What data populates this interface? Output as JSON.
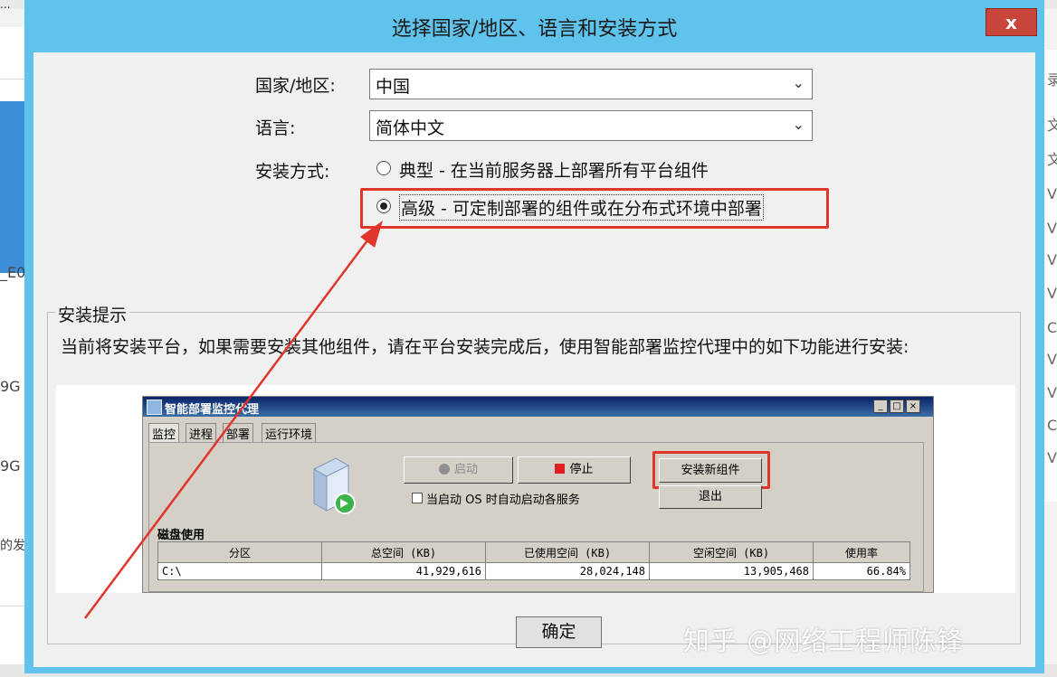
{
  "background": {
    "top_text": "...",
    "left_texts": [
      "_E0",
      "9G",
      "9G",
      "的发"
    ],
    "right_texts": [
      "录",
      "文",
      "文",
      "V",
      "V",
      "V",
      "V",
      "C",
      "V",
      "V",
      "C",
      "V"
    ]
  },
  "dialog": {
    "title": "选择国家/地区、语言和安装方式",
    "close_label": "x",
    "country": {
      "label": "国家/地区:",
      "value": "中国"
    },
    "language": {
      "label": "语言:",
      "value": "简体中文"
    },
    "install_mode": {
      "label": "安装方式:",
      "options": [
        {
          "label": "典型 - 在当前服务器上部署所有平台组件",
          "selected": false
        },
        {
          "label": "高级 - 可定制部署的组件或在分布式环境中部署",
          "selected": true
        }
      ]
    },
    "tip": {
      "title": "安装提示",
      "text": "当前将安装平台，如果需要安装其他组件，请在平台安装完成后，使用智能部署监控代理中的如下功能进行安装:"
    },
    "ok_label": "确定"
  },
  "embedded_window": {
    "title": "智能部署监控代理",
    "controls": [
      "_",
      "□",
      "×"
    ],
    "tabs": [
      "监控",
      "进程",
      "部署",
      "运行环境"
    ],
    "buttons": {
      "start": "启动",
      "stop": "停止",
      "install_new": "安装新组件",
      "exit": "退出"
    },
    "autostart_label": "当启动 OS 时自动启动各服务",
    "disk_section_label": "磁盘使用",
    "disk_table": {
      "columns": [
        "分区",
        "总空间 (KB)",
        "已使用空间 (KB)",
        "空闲空间 (KB)",
        "使用率"
      ],
      "rows": [
        [
          "C:\\",
          "41,929,616",
          "28,024,148",
          "13,905,468",
          "66.84%"
        ]
      ]
    }
  },
  "watermark": "知乎 @网络工程师陈锋",
  "colors": {
    "dialog_frame": "#5fc3ec",
    "annotation_red": "#e0352b",
    "close_red": "#c7453b"
  }
}
